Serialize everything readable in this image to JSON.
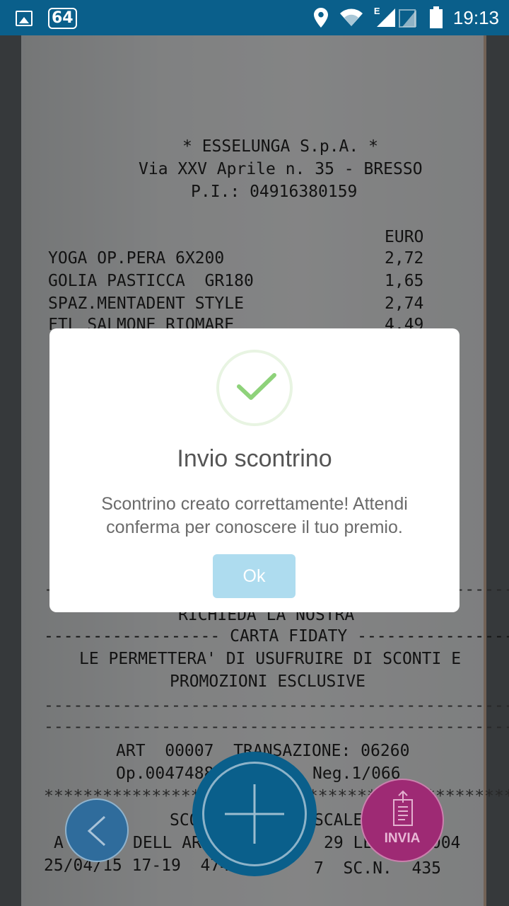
{
  "status_bar": {
    "badge": "64",
    "time": "19:13",
    "network_label": "E",
    "icons": [
      "image-icon",
      "location-icon",
      "wifi-icon",
      "signal-icon",
      "battery-icon"
    ]
  },
  "receipt": {
    "lines": [
      "* ESSELUNGA S.p.A. *",
      "Via XXV Aprile n. 35 - BRESSO",
      "P.I.: 04916380159",
      "EURO",
      "YOGA OP.PERA 6X200",
      "2,72",
      "GOLIA PASTICCA  GR180",
      "1,65",
      "SPAZ.MENTADENT STYLE",
      "2,74",
      "FTL SALMONE RIOMARE",
      "4,49",
      "RICHIEDA LA NOSTRA",
      "------------------ CARTA FIDATY ------------------",
      "LE PERMETTERA' DI USUFRUIRE DI SCONTI E",
      "PROMOZIONI ESCLUSIVE",
      "ART  00007  TRANSAZIONE: 06260",
      "Op.0047488",
      "Neg.1/066",
      "SCO",
      "SCALE",
      "A",
      "DELL AR",
      "29 LEGG",
      "2004",
      "25/04/15 17-19  4748",
      "7  SC.N.  435"
    ]
  },
  "dialog": {
    "title": "Invio scontrino",
    "message": "Scontrino creato correttamente! Attendi conferma per conoscere il tuo premio.",
    "ok_label": "Ok"
  },
  "bottom_bar": {
    "send_label": "INVIA"
  },
  "colors": {
    "status_bar": "#0a5f8b",
    "ok_button": "#aedcef",
    "check": "#8ed27a",
    "send_button": "#9e2a74",
    "back_button": "#2f6c9c"
  }
}
